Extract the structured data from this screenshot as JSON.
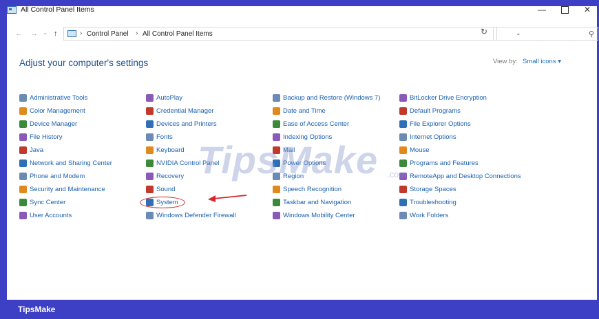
{
  "window": {
    "title": "All Control Panel Items",
    "min_glyph": "—",
    "close_glyph": "✕"
  },
  "nav": {
    "back_glyph": "←",
    "forward_glyph": "→",
    "recent_glyph": "⌄",
    "up_glyph": "↑"
  },
  "address": {
    "crumb_sep": "›",
    "crumbs": [
      "Control Panel",
      "All Control Panel Items"
    ],
    "dropdown_glyph": "⌄",
    "refresh_glyph": "↻"
  },
  "search": {
    "placeholder": "",
    "icon_glyph": "⚲"
  },
  "content": {
    "heading": "Adjust your computer's settings",
    "view_by_label": "View by:",
    "view_by_value": "Small icons ▾"
  },
  "items": [
    [
      "Administrative Tools",
      "Color Management",
      "Device Manager",
      "File History",
      "Java",
      "Network and Sharing Center",
      "Phone and Modem",
      "Security and Maintenance",
      "Sync Center",
      "User Accounts"
    ],
    [
      "AutoPlay",
      "Credential Manager",
      "Devices and Printers",
      "Fonts",
      "Keyboard",
      "NVIDIA Control Panel",
      "Recovery",
      "Sound",
      "System",
      "Windows Defender Firewall"
    ],
    [
      "Backup and Restore (Windows 7)",
      "Date and Time",
      "Ease of Access Center",
      "Indexing Options",
      "Mail",
      "Power Options",
      "Region",
      "Speech Recognition",
      "Taskbar and Navigation",
      "Windows Mobility Center"
    ],
    [
      "BitLocker Drive Encryption",
      "Default Programs",
      "File Explorer Options",
      "Internet Options",
      "Mouse",
      "Programs and Features",
      "RemoteApp and Desktop Connections",
      "Storage Spaces",
      "Troubleshooting",
      "Work Folders"
    ]
  ],
  "icon_colors": [
    "#6b8bb5",
    "#e08a1e",
    "#3a8a3a",
    "#8a5ab8",
    "#c0392b",
    "#2f6fb5"
  ],
  "accent_colors": {
    "frame": "#3d3fc4",
    "link": "#1a5fb0",
    "heading": "#1f4f8f",
    "highlight": "#d8262b"
  },
  "watermark": {
    "text": "TipsMake",
    "suffix": ".com"
  },
  "footer": {
    "brand": "TipsMake"
  }
}
